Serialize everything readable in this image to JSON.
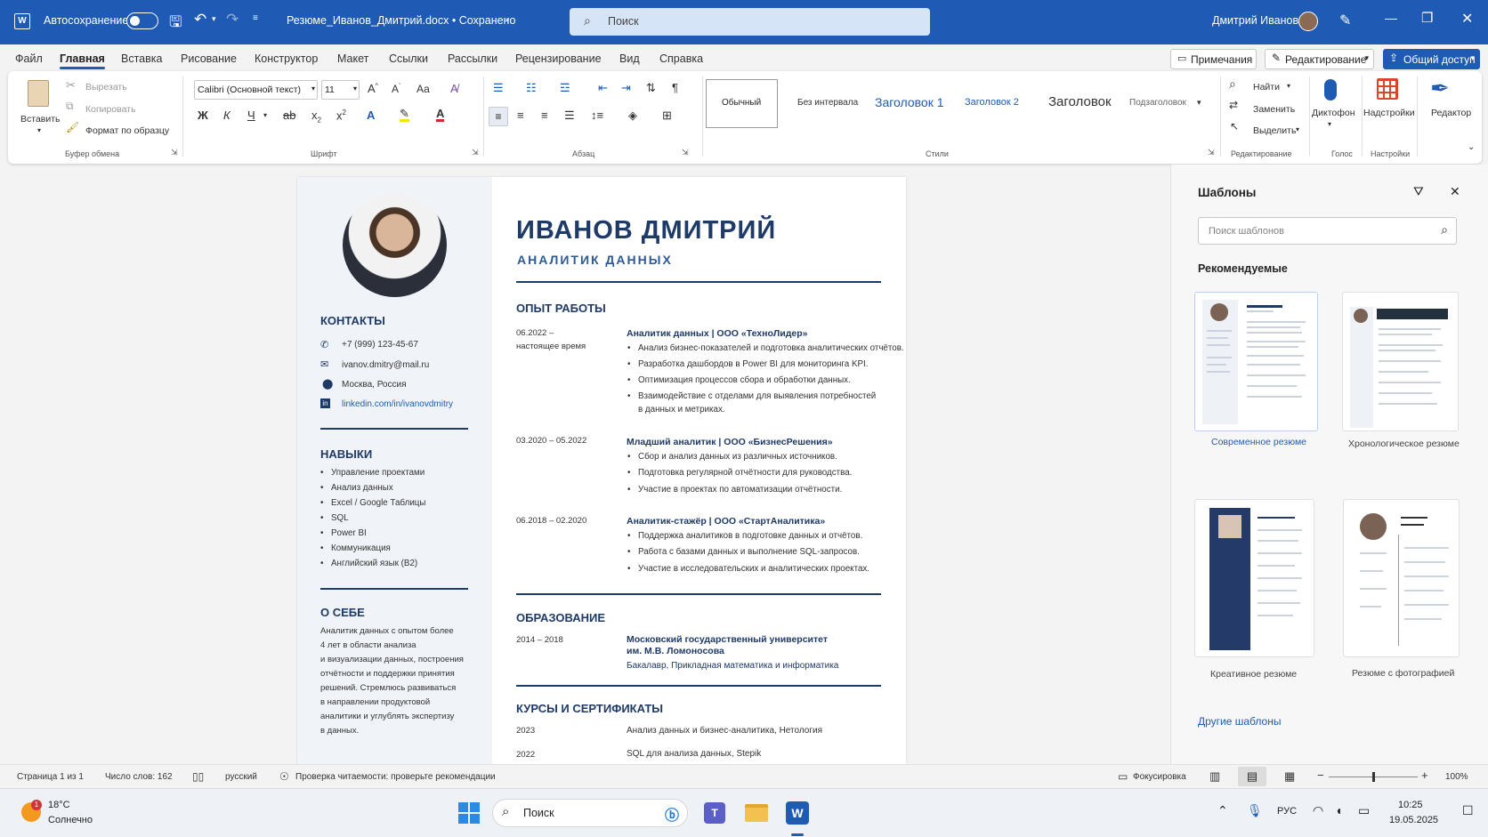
{
  "titlebar": {
    "autosave_label": "Автосохранение",
    "doc_title": "Резюме_Иванов_Дмитрий.docx • Сохранено",
    "search_placeholder": "Поиск",
    "user_name": "Дмитрий Иванов"
  },
  "menu": {
    "items": [
      "Файл",
      "Главная",
      "Вставка",
      "Рисование",
      "Конструктор",
      "Макет",
      "Ссылки",
      "Рассылки",
      "Рецензирование",
      "Вид",
      "Справка"
    ],
    "active": "Главная",
    "comments": "Примечания",
    "editing_mode": "Редактирование",
    "share": "Общий доступ"
  },
  "ribbon": {
    "clipboard": {
      "paste": "Вставить",
      "cut": "Вырезать",
      "copy": "Копировать",
      "format_painter": "Формат по образцу",
      "group": "Буфер обмена"
    },
    "font": {
      "name": "Calibri (Основной текст)",
      "size": "11",
      "group": "Шрифт",
      "bold": "Ж",
      "italic": "К",
      "underline": "Ч",
      "case": "Аа"
    },
    "paragraph": {
      "group": "Абзац"
    },
    "styles": {
      "items": [
        "Обычный",
        "Без интервала",
        "Заголовок 1",
        "Заголовок 2",
        "Заголовок",
        "Подзаголовок"
      ],
      "group": "Стили"
    },
    "editing": {
      "find": "Найти",
      "replace": "Заменить",
      "select": "Выделить",
      "group": "Редактирование"
    },
    "voice": {
      "dictate": "Диктофон",
      "group": "Голос"
    },
    "addins": {
      "label": "Надстройки",
      "group": "Настройки"
    },
    "editor": {
      "label": "Редактор"
    }
  },
  "resume": {
    "name": "ИВАНОВ ДМИТРИЙ",
    "title": "АНАЛИТИК ДАННЫХ",
    "contacts_heading": "КОНТАКТЫ",
    "contacts": [
      "+7 (999) 123-45-67",
      "ivanov.dmitry@mail.ru",
      "Москва, Россия",
      "linkedin.com/in/ivanovdmitry"
    ],
    "skills_heading": "НАВЫКИ",
    "skills": [
      "Управление проектами",
      "Анализ данных",
      "Excel / Google Таблицы",
      "SQL",
      "Power BI",
      "Коммуникация",
      "Английский язык (B2)"
    ],
    "about_heading": "О СЕБЕ",
    "about_lines": [
      "Аналитик данных с опытом более",
      "4 лет в области анализа",
      "и визуализации данных, построения",
      "отчётности и поддержки принятия",
      "решений. Стремлюсь развиваться",
      "в направлении продуктовой",
      "аналитики и углублять экспертизу",
      "в данных."
    ],
    "experience_heading": "ОПЫТ РАБОТЫ",
    "jobs": [
      {
        "dates": "06.2022 –",
        "dates2": "настоящее время",
        "role": "Аналитик данных  |  ООО «ТехноЛидер»",
        "bullets": [
          "Анализ бизнес-показателей и подготовка аналитических отчётов.",
          "Разработка дашбордов в Power BI для мониторинга KPI.",
          "Оптимизация процессов сбора и обработки данных.",
          "Взаимодействие с отделами для выявления потребностей",
          "в данных и метриках."
        ]
      },
      {
        "dates": "03.2020 – 05.2022",
        "dates2": "",
        "role": "Младший аналитик  |  ООО «БизнесРешения»",
        "bullets": [
          "Сбор и анализ данных из различных источников.",
          "Подготовка регулярной отчётности для руководства.",
          "Участие в проектах по автоматизации отчётности."
        ]
      },
      {
        "dates": "06.2018 – 02.2020",
        "dates2": "",
        "role": "Аналитик-стажёр  |  ООО «СтартАналитика»",
        "bullets": [
          "Поддержка аналитиков в подготовке данных и отчётов.",
          "Работа с базами данных и выполнение SQL-запросов.",
          "Участие в исследовательских и аналитических проектах."
        ]
      }
    ],
    "education_heading": "ОБРАЗОВАНИЕ",
    "education": {
      "dates": "2014 – 2018",
      "school1": "Московский государственный университет",
      "school2": "им. М.В. Ломоносова",
      "degree": "Бакалавр, Прикладная математика и информатика"
    },
    "courses_heading": "КУРСЫ И СЕРТИФИКАТЫ",
    "courses": [
      {
        "year": "2023",
        "name": "Анализ данных и бизнес-аналитика, Нетология"
      },
      {
        "year": "2022",
        "name": "SQL для анализа данных, Stepik"
      }
    ]
  },
  "pane": {
    "title": "Шаблоны",
    "search_placeholder": "Поиск шаблонов",
    "recommended": "Рекомендуемые",
    "templates": [
      "Современное резюме",
      "Хронологическое резюме",
      "Креативное резюме",
      "Резюме с фотографией"
    ],
    "more": "Другие шаблоны"
  },
  "status": {
    "page": "Страница 1 из 1",
    "words": "Число слов: 162",
    "language": "русский",
    "accessibility": "Проверка читаемости: проверьте рекомендации",
    "focus": "Фокусировка",
    "zoom": "100%",
    "zoom_level": 0.5
  },
  "taskbar": {
    "temp": "18°C",
    "weather": "Солнечно",
    "badge": "1",
    "search": "Поиск",
    "lang": "РУС",
    "time": "10:25",
    "date": "19.05.2025"
  },
  "colors": {
    "titlebar": "#1f5bb4",
    "resume_accent": "#1e3a66",
    "link": "#1f5bb4"
  }
}
